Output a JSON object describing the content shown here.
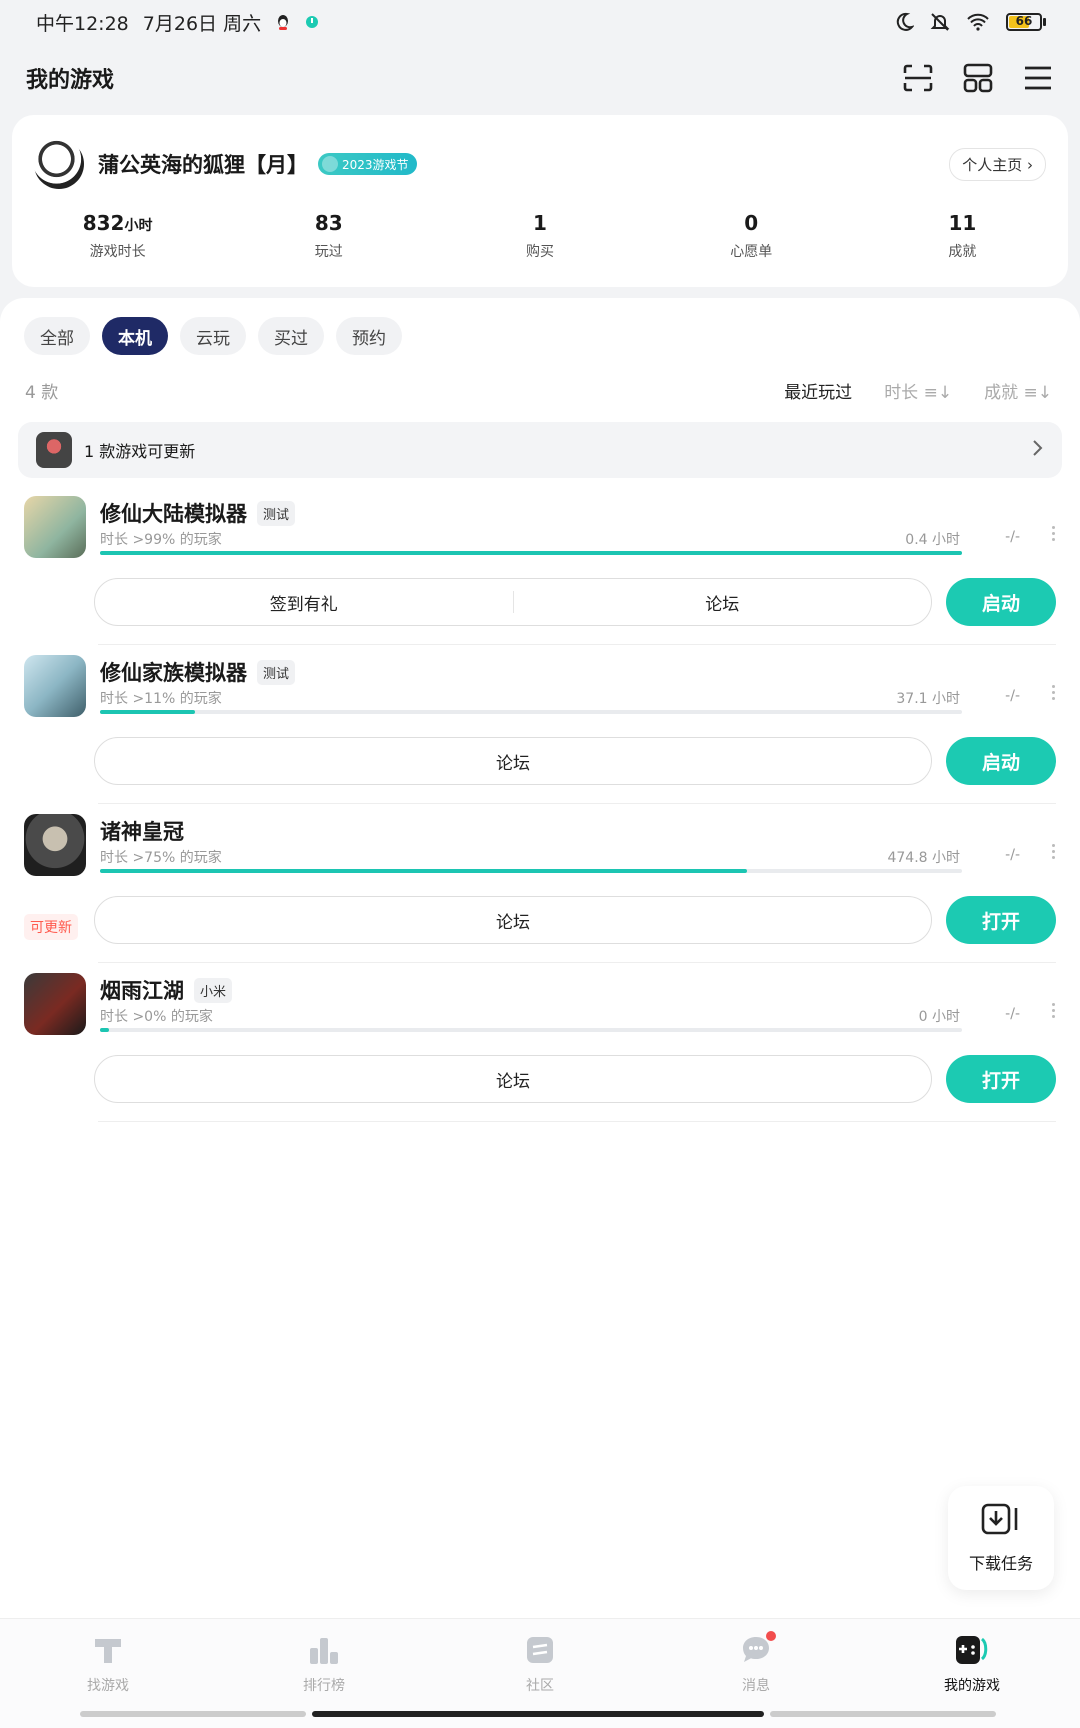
{
  "status": {
    "time": "中午12:28",
    "date": "7月26日 周六",
    "battery": "66"
  },
  "header": {
    "title": "我的游戏"
  },
  "profile": {
    "username": "蒲公英海的狐狸【月】",
    "badge": "2023游戏节",
    "home_link": "个人主页 ›",
    "stats": [
      {
        "value": "832",
        "unit": "小时",
        "label": "游戏时长"
      },
      {
        "value": "83",
        "unit": "",
        "label": "玩过"
      },
      {
        "value": "1",
        "unit": "",
        "label": "购买"
      },
      {
        "value": "0",
        "unit": "",
        "label": "心愿单"
      },
      {
        "value": "11",
        "unit": "",
        "label": "成就"
      }
    ]
  },
  "tabs": [
    "全部",
    "本机",
    "云玩",
    "买过",
    "预约"
  ],
  "active_tab": "本机",
  "count_text": "4 款",
  "sorts": [
    {
      "label": "最近玩过"
    },
    {
      "label": "时长 ≡↓"
    },
    {
      "label": "成就 ≡↓"
    }
  ],
  "update_bar": {
    "text": "1 款游戏可更新"
  },
  "games": [
    {
      "name": "修仙大陆模拟器",
      "tag": "测试",
      "sub": "时长 >99% 的玩家",
      "hours": "0.4 小时",
      "rate": "-/-",
      "progress": 1.0,
      "buttons": [
        "签到有礼",
        "论坛"
      ],
      "action": "启动",
      "update_badge": ""
    },
    {
      "name": "修仙家族模拟器",
      "tag": "测试",
      "sub": "时长 >11% 的玩家",
      "hours": "37.1 小时",
      "rate": "-/-",
      "progress": 0.11,
      "buttons": [
        "论坛"
      ],
      "action": "启动",
      "update_badge": ""
    },
    {
      "name": "诸神皇冠",
      "tag": "",
      "sub": "时长 >75% 的玩家",
      "hours": "474.8 小时",
      "rate": "-/-",
      "progress": 0.75,
      "buttons": [
        "论坛"
      ],
      "action": "打开",
      "update_badge": "可更新"
    },
    {
      "name": "烟雨江湖",
      "tag": "小米",
      "sub": "时长 >0% 的玩家",
      "hours": "0 小时",
      "rate": "-/-",
      "progress": 0.01,
      "buttons": [
        "论坛"
      ],
      "action": "打开",
      "update_badge": ""
    }
  ],
  "download_task": "下载任务",
  "bottom_nav": [
    {
      "label": "找游戏",
      "icon": "find-games-icon"
    },
    {
      "label": "排行榜",
      "icon": "ranking-icon"
    },
    {
      "label": "社区",
      "icon": "community-icon"
    },
    {
      "label": "消息",
      "icon": "message-icon"
    },
    {
      "label": "我的游戏",
      "icon": "my-games-icon"
    }
  ],
  "colors": {
    "accent": "#1ccab2",
    "active_tab": "#1f2a66",
    "update_red": "#ff5a4e"
  }
}
